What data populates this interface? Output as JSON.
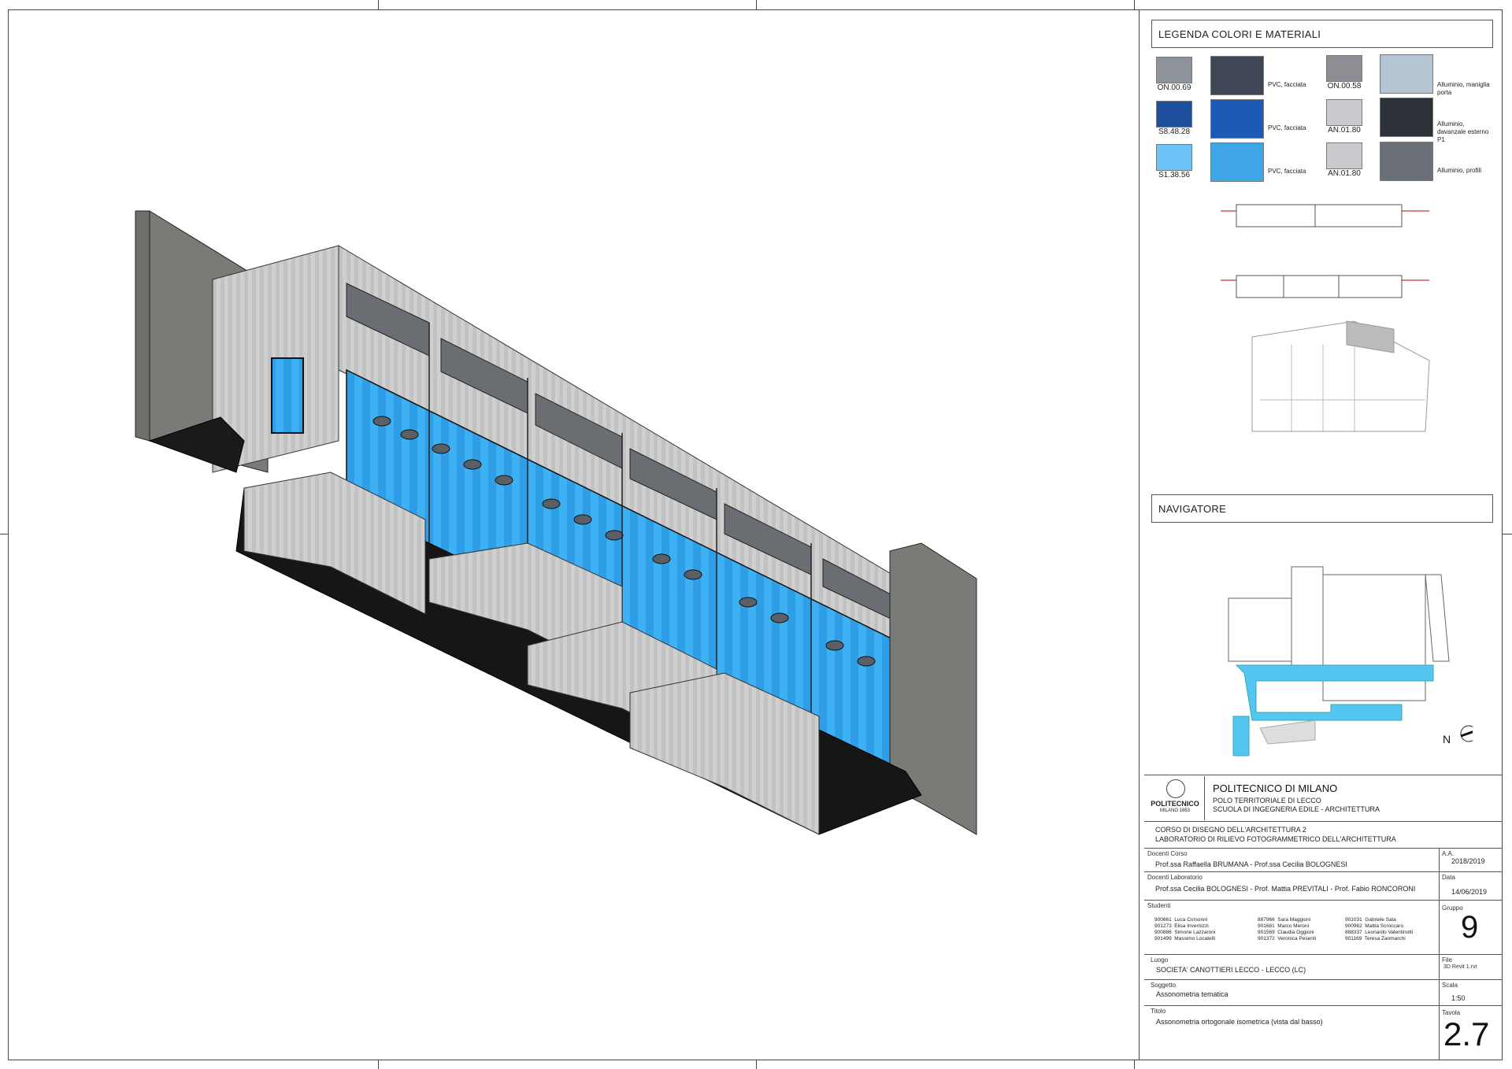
{
  "legend": {
    "title": "LEGENDA COLORI E MATERIALI",
    "swatches": [
      {
        "code": "ON.00.69",
        "color": "#8f949c",
        "material_label": "PVC, facciata",
        "material_color": "#3e4753"
      },
      {
        "code": "S8.48.28",
        "color": "#1e4f9e",
        "material_label": "PVC, facciata",
        "material_color": "#1d59b7"
      },
      {
        "code": "S1.38.56",
        "color": "#6bc4f5",
        "material_label": "PVC, facciata",
        "material_color": "#3ea6e6"
      },
      {
        "code": "ON.00.58",
        "color": "#8c8e93",
        "material_label": "Alluminio, maniglia porta",
        "material_color": "#b5c4d2"
      },
      {
        "code": "AN.01.80",
        "color": "#c9cbce",
        "material_label": "Alluminio, davanzale esterno P1",
        "material_color": "#2c3238"
      },
      {
        "code": "AN.01.80",
        "color": "#c9cbce",
        "material_label": "Alluminio, profili",
        "material_color": "#6b7078"
      }
    ]
  },
  "navigator": {
    "title": "NAVIGATORE",
    "compass": "N"
  },
  "titleblock": {
    "logo_text": "POLITECNICO",
    "logo_sub": "MILANO 1863",
    "university": "POLITECNICO DI MILANO",
    "campus": "POLO TERRITORIALE DI LECCO",
    "school": "SCUOLA DI INGEGNERIA EDILE - ARCHITETTURA",
    "course1": "CORSO DI DISEGNO DELL'ARCHITETTURA 2",
    "course2": "LABORATORIO DI RILIEVO FOTOGRAMMETRICO DELL'ARCHITETTURA",
    "docenti_corso_label": "Docenti Corso",
    "docenti_corso": "Prof.ssa Raffaella BRUMANA - Prof.ssa Cecilia BOLOGNESI",
    "aa_label": "A.A.",
    "aa": "2018/2019",
    "docenti_lab_label": "Docenti Laboratorio",
    "docenti_lab": "Prof.ssa Cecilia BOLOGNESI - Prof. Mattia PREVITALI - Prof. Fabio RONCORONI",
    "data_label": "Data",
    "data": "14/06/2019",
    "studenti_label": "Studenti",
    "students_col1": "900661  Luca Corsonni\n901273  Elisa Invernizzi\n900886  Simone Lazzaroni\n901499  Massimo Locatelli",
    "students_col2": "887966  Sara Maggioni\n901681  Marco Meroni\n901569  Claudia Oggioni\n901372  Veronica Pesenti",
    "students_col3": "901031  Gabriele Sala\n900962  Mattia Scroccaro\n888337  Leonardo Valentinotti\n901169  Teresa Zanmarchi",
    "gruppo_label": "Gruppo",
    "gruppo": "9",
    "luogo_label": "Luogo",
    "luogo": "SOCIETA' CANOTTIERI LECCO - LECCO (LC)",
    "file_label": "File",
    "file": "3D Revit 1.rvt",
    "soggetto_label": "Soggetto",
    "soggetto": "Assonometria tematica",
    "scala_label": "Scala",
    "scala": "1:50",
    "titolo_label": "Titolo",
    "titolo": "Assonometria ortogonale isometrica (vista dal basso)",
    "tavola_label": "Tavola",
    "tavola": "2.7"
  },
  "colors": {
    "wall_grey": "#c8c8c8",
    "dark_wall": "#6f6f6b",
    "glass_blue": "#33a7f2",
    "deep_blue": "#1d6fd6",
    "black": "#141414"
  }
}
